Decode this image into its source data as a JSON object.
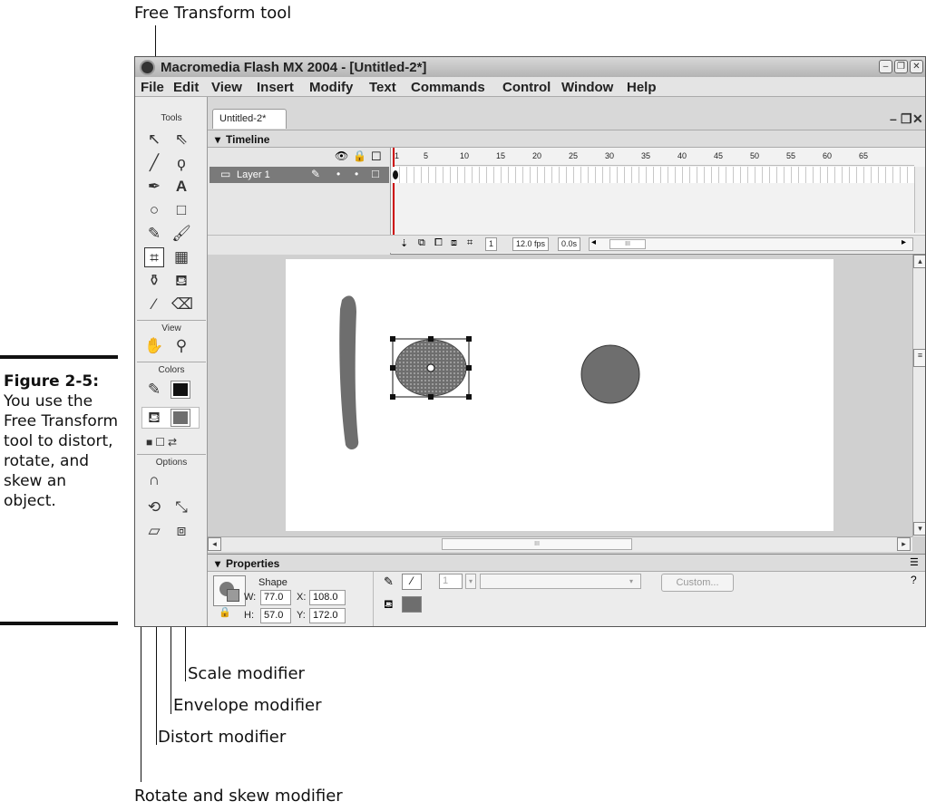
{
  "callouts": {
    "free_transform": "Free Transform tool",
    "scale": "Scale modifier",
    "envelope": "Envelope modifier",
    "distort": "Distort modifier",
    "rotate_skew": "Rotate and skew modifier"
  },
  "caption": {
    "label": "Figure 2-5:",
    "text": "You use the Free Transform tool to distort, rotate, and skew an object."
  },
  "window": {
    "title": "Macromedia Flash MX 2004 - [Untitled-2*]",
    "menu": [
      "File",
      "Edit",
      "View",
      "Insert",
      "Modify",
      "Text",
      "Commands",
      "Control",
      "Window",
      "Help"
    ]
  },
  "tools_panel": {
    "tools_label": "Tools",
    "view_label": "View",
    "colors_label": "Colors",
    "options_label": "Options",
    "selected_tool": "free-transform-tool"
  },
  "document": {
    "tab": "Untitled-2*",
    "timeline_title": "Timeline",
    "layer_name": "Layer 1",
    "frame_numbers": [
      "1",
      "5",
      "10",
      "15",
      "20",
      "25",
      "30",
      "35",
      "40",
      "45",
      "50",
      "55",
      "60",
      "65"
    ],
    "current_frame": "1",
    "fps": "12.0 fps",
    "elapsed": "0.0s",
    "scroll_label": "III"
  },
  "properties": {
    "title": "Properties",
    "type": "Shape",
    "stroke_height": "1",
    "custom_button": "Custom...",
    "w_label": "W:",
    "w": "77.0",
    "x_label": "X:",
    "x": "108.0",
    "h_label": "H:",
    "h": "57.0",
    "y_label": "Y:",
    "y": "172.0"
  },
  "colors": {
    "shape_fill": "#6e6e6e",
    "stage": "#ffffff",
    "workspace": "#d0d0d0"
  }
}
